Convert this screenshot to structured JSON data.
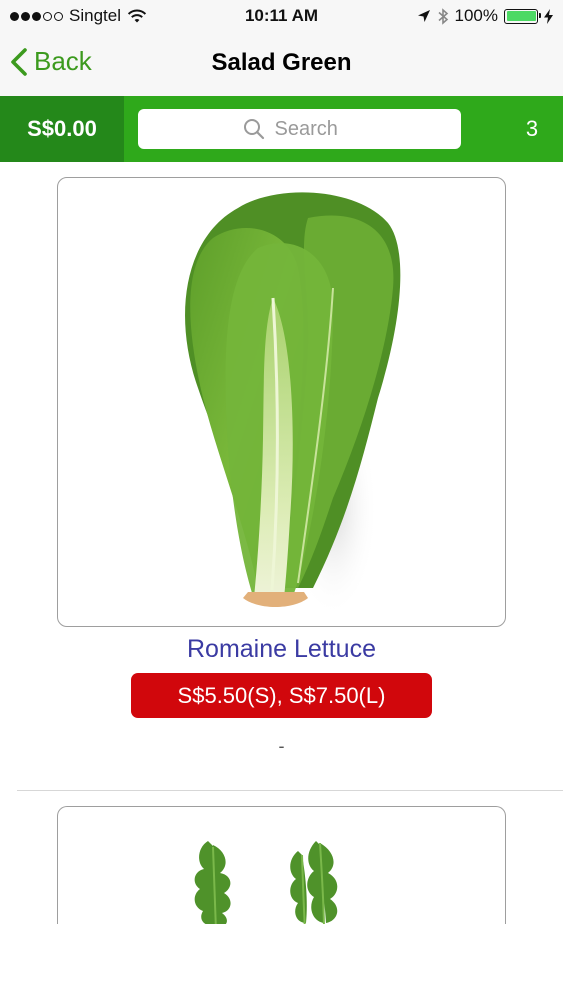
{
  "status_bar": {
    "carrier": "Singtel",
    "time": "10:11 AM",
    "battery": "100%",
    "battery_level": 1.0,
    "icons": [
      "wifi-icon",
      "location-arrow-icon",
      "bluetooth-icon",
      "battery-icon",
      "charging-bolt-icon"
    ]
  },
  "nav": {
    "back_label": "Back",
    "title": "Salad Green"
  },
  "toolbar": {
    "total": "S$0.00",
    "search_placeholder": "Search",
    "cart_count": "3"
  },
  "products": [
    {
      "name": "Romaine Lettuce",
      "price": "S$5.50(S), S$7.50(L)",
      "description": "-",
      "image": "romaine-lettuce-image"
    },
    {
      "image": "arugula-image"
    }
  ],
  "colors": {
    "accent_green": "#3c9a1e",
    "toolbar_green": "#2fa91b",
    "toolbar_dark_green": "#24881a",
    "price_red": "#d1070c",
    "product_name_blue": "#3b3ba3"
  }
}
